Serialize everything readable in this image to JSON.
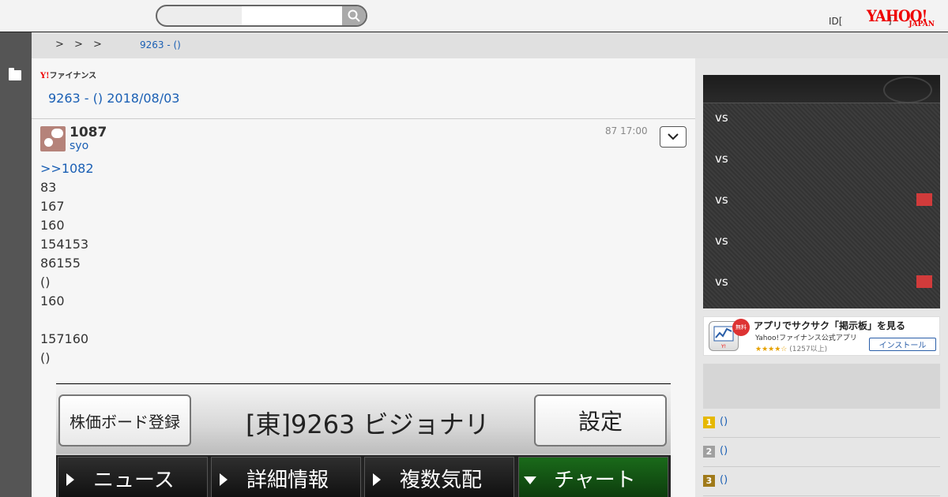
{
  "header": {
    "search_placeholder": "",
    "login_label": "ID[",
    "login_bracket": "]",
    "logo_text": "YAHOO!",
    "logo_sub": "JAPAN"
  },
  "breadcrumb": {
    "separators": [
      ">",
      ">",
      ">"
    ],
    "current": "9263 - ()"
  },
  "brand": {
    "yf_prefix": "Y!",
    "yf_label": "ファイナンス"
  },
  "thread": {
    "title": "9263 - () 2018/08/03"
  },
  "post": {
    "number": "1087",
    "author": "syo",
    "time": "87 17:00",
    "reply_to": ">>1082",
    "lines": [
      "83",
      "167",
      "160",
      "154153",
      "86155",
      "()",
      "160",
      "",
      "157160",
      "()"
    ]
  },
  "embedded_screenshot": {
    "left_button": "株価ボード登録",
    "title": "[東]9263 ビジョナリ",
    "right_button": "設定",
    "tabs": [
      "ニュース",
      "詳細情報",
      "複数気配",
      "チャート"
    ]
  },
  "scoreboard": {
    "rows": [
      {
        "label": "vs",
        "flag": false
      },
      {
        "label": "vs",
        "flag": false
      },
      {
        "label": "vs",
        "flag": true
      },
      {
        "label": "vs",
        "flag": false
      },
      {
        "label": "vs",
        "flag": true
      }
    ],
    "flag_color": "#d13b3b"
  },
  "ad": {
    "badge": "無料",
    "title": "アプリでサクサク「掲示板」を見る",
    "subtitle": "Yahoo!ファイナンス公式アプリ",
    "stars": "★★★★☆",
    "rating_count": "(1257以上)",
    "install_label": "インストール"
  },
  "ranking": [
    {
      "rank": "1",
      "text": "()",
      "color": "#e6b800"
    },
    {
      "rank": "2",
      "text": "()",
      "color": "#a0a0a0"
    },
    {
      "rank": "3",
      "text": "()",
      "color": "#a07a1a"
    }
  ],
  "colors": {
    "link": "#1a5fb4",
    "brand_red": "#e00000"
  }
}
